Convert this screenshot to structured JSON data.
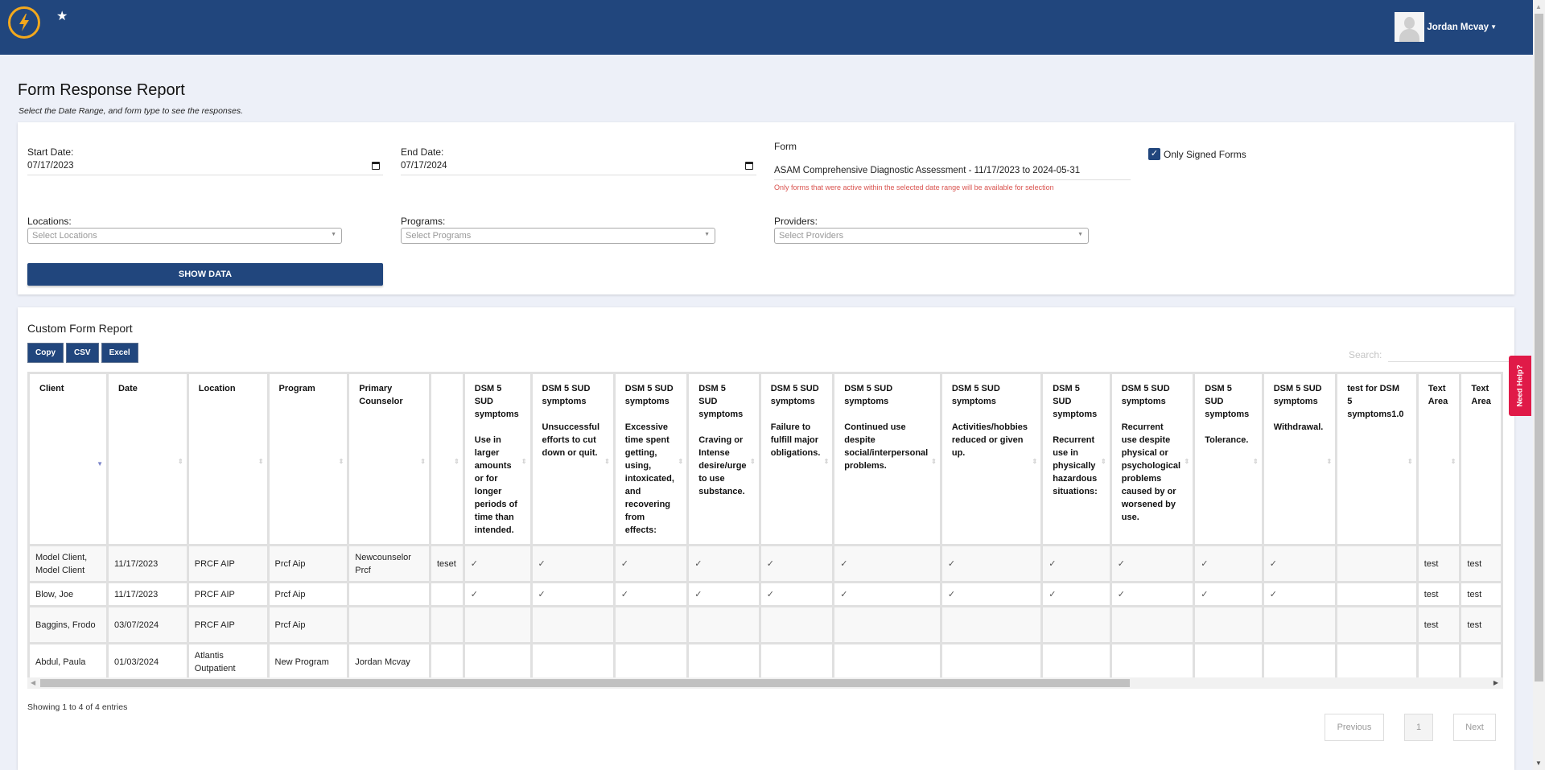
{
  "header": {
    "logo_icon": "lightning-bolt-icon",
    "favorite_icon": "star-icon",
    "user_name": "Jordan Mcvay",
    "user_menu_icon": "caret-down-icon"
  },
  "page": {
    "title": "Form Response Report",
    "subtitle": "Select the Date Range, and form type to see the responses."
  },
  "filters": {
    "start_date_label": "Start Date:",
    "start_date_value": "07/17/2023",
    "end_date_label": "End Date:",
    "end_date_value": "07/17/2024",
    "form_label": "Form",
    "form_value": "ASAM Comprehensive Diagnostic Assessment - 11/17/2023 to 2024-05-31",
    "form_hint": "Only forms that were active within the selected date range will be available for selection",
    "only_signed_label": "Only Signed Forms",
    "only_signed_checked": true,
    "locations_label": "Locations:",
    "locations_placeholder": "Select Locations",
    "programs_label": "Programs:",
    "programs_placeholder": "Select Programs",
    "providers_label": "Providers:",
    "providers_placeholder": "Select Providers",
    "show_data_label": "SHOW DATA"
  },
  "report": {
    "title": "Custom Form Report",
    "buttons": [
      "Copy",
      "CSV",
      "Excel"
    ],
    "search_label": "Search:",
    "search_value": "",
    "columns": [
      "Client",
      "Date",
      "Location",
      "Program",
      "Primary\nCounselor",
      "",
      "DSM 5\nSUD\nsymptoms\n\nUse in\nlarger\namounts\nor for\nlonger\nperiods of\ntime than\nintended.",
      "DSM 5 SUD\nsymptoms\n\nUnsuccessful\nefforts to cut\ndown or quit.",
      "DSM 5 SUD\nsymptoms\n\nExcessive\ntime spent\ngetting,\nusing,\nintoxicated,\nand\nrecovering\nfrom\neffects:",
      "DSM 5\nSUD\nsymptoms\n\nCraving or\nIntense\ndesire/urge\nto use\nsubstance.",
      "DSM 5 SUD\nsymptoms\n\nFailure to\nfulfill major\nobligations.",
      "DSM 5 SUD\nsymptoms\n\nContinued use\ndespite\nsocial/interpersonal\nproblems.",
      "DSM 5 SUD\nsymptoms\n\nActivities/hobbies\nreduced or given\nup.",
      "DSM 5\nSUD\nsymptoms\n\nRecurrent\nuse in\nphysically\nhazardous\nsituations:",
      "DSM 5 SUD\nsymptoms\n\nRecurrent\nuse despite\nphysical or\npsychological\nproblems\ncaused by or\nworsened by\nuse.",
      "DSM 5\nSUD\nsymptoms\n\nTolerance.",
      "DSM 5 SUD\nsymptoms\n\nWithdrawal.",
      "test for DSM\n5\nsymptoms1.0",
      "Text\nArea",
      "Text\nArea"
    ],
    "sorted_column": "Client",
    "rows": [
      [
        "Model Client, Model Client",
        "11/17/2023",
        "PRCF AIP",
        "Prcf Aip",
        "Newcounselor Prcf",
        "teset",
        "✓",
        "✓",
        "✓",
        "✓",
        "✓",
        "✓",
        "✓",
        "✓",
        "✓",
        "✓",
        "✓",
        "",
        "test",
        "test"
      ],
      [
        "Blow, Joe",
        "11/17/2023",
        "PRCF AIP",
        "Prcf Aip",
        "",
        "",
        "✓",
        "✓",
        "✓",
        "✓",
        "✓",
        "✓",
        "✓",
        "✓",
        "✓",
        "✓",
        "✓",
        "",
        "test",
        "test"
      ],
      [
        "Baggins, Frodo",
        "03/07/2024",
        "PRCF AIP",
        "Prcf Aip",
        "",
        "",
        "",
        "",
        "",
        "",
        "",
        "",
        "",
        "",
        "",
        "",
        "",
        "",
        "test",
        "test"
      ],
      [
        "Abdul, Paula",
        "01/03/2024",
        "Atlantis Outpatient",
        "New Program",
        "Jordan Mcvay",
        "",
        "",
        "",
        "",
        "",
        "",
        "",
        "",
        "",
        "",
        "",
        "",
        "",
        "",
        ""
      ]
    ],
    "info": "Showing 1 to 4 of 4 entries",
    "pagination": {
      "previous": "Previous",
      "current": "1",
      "next": "Next"
    }
  },
  "help_tab": "Need Help?"
}
